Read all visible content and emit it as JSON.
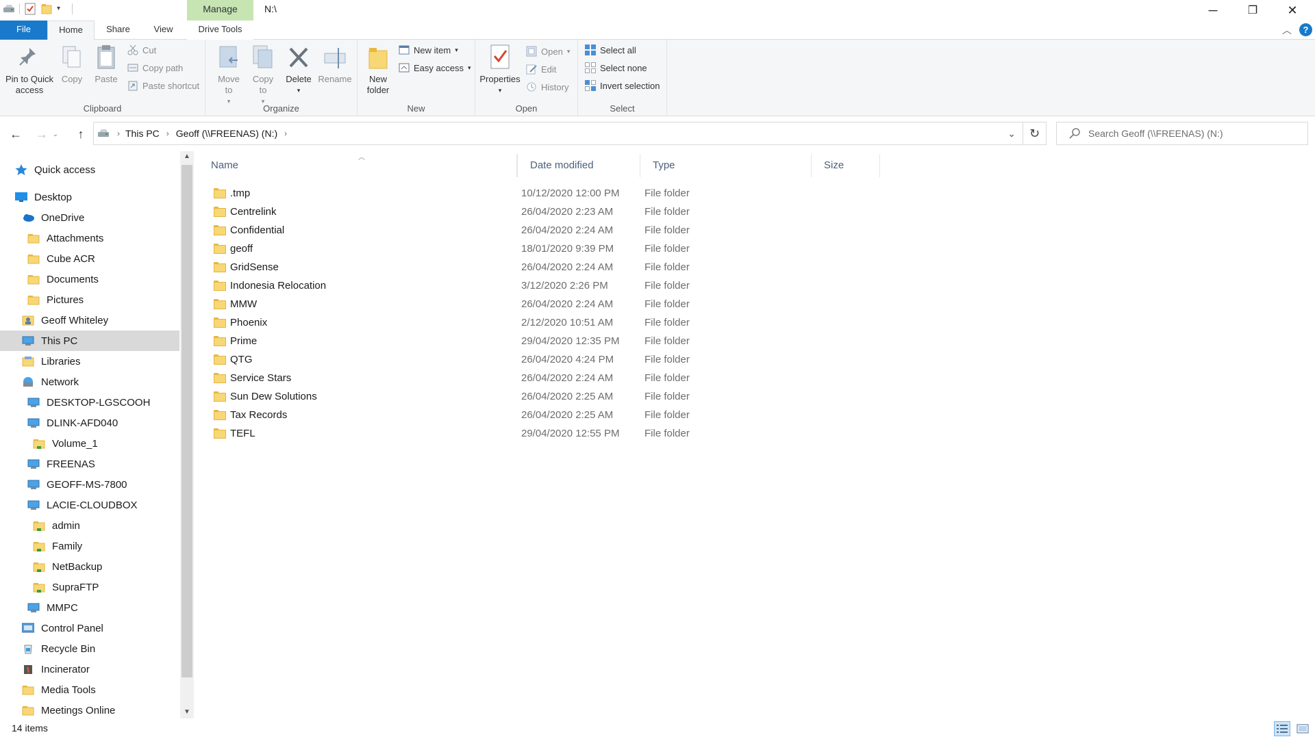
{
  "titlebar": {
    "manage_label": "Manage",
    "title": "N:\\",
    "minimize": "─",
    "restore": "❐",
    "close": "✕"
  },
  "ribbon_tabs": {
    "file": "File",
    "home": "Home",
    "share": "Share",
    "view": "View",
    "drive_tools": "Drive Tools"
  },
  "ribbon": {
    "clipboard": {
      "label": "Clipboard",
      "pin": "Pin to Quick access",
      "copy": "Copy",
      "paste": "Paste",
      "cut": "Cut",
      "copy_path": "Copy path",
      "paste_shortcut": "Paste shortcut"
    },
    "organize": {
      "label": "Organize",
      "move_to": "Move to",
      "copy_to": "Copy to",
      "delete": "Delete",
      "rename": "Rename"
    },
    "new": {
      "label": "New",
      "new_folder": "New folder",
      "new_item": "New item",
      "easy_access": "Easy access"
    },
    "open": {
      "label": "Open",
      "properties": "Properties",
      "open": "Open",
      "edit": "Edit",
      "history": "History"
    },
    "select": {
      "label": "Select",
      "select_all": "Select all",
      "select_none": "Select none",
      "invert": "Invert selection"
    }
  },
  "address": {
    "crumbs": [
      "This PC",
      "Geoff (\\\\FREENAS) (N:)"
    ],
    "search_placeholder": "Search Geoff (\\\\FREENAS) (N:)"
  },
  "nav": {
    "items": [
      {
        "label": "Quick access",
        "icon": "star-icon",
        "indent": 0
      },
      {
        "label": "Desktop",
        "icon": "desktop-icon",
        "indent": 0
      },
      {
        "label": "OneDrive",
        "icon": "cloud-icon",
        "indent": 1
      },
      {
        "label": "Attachments",
        "icon": "folder-icon",
        "indent": 2
      },
      {
        "label": "Cube ACR",
        "icon": "folder-icon",
        "indent": 2
      },
      {
        "label": "Documents",
        "icon": "folder-icon",
        "indent": 2
      },
      {
        "label": "Pictures",
        "icon": "folder-icon",
        "indent": 2
      },
      {
        "label": "Geoff Whiteley",
        "icon": "user-icon",
        "indent": 1
      },
      {
        "label": "This PC",
        "icon": "computer-icon",
        "indent": 1,
        "selected": true
      },
      {
        "label": "Libraries",
        "icon": "library-icon",
        "indent": 1
      },
      {
        "label": "Network",
        "icon": "network-icon",
        "indent": 1
      },
      {
        "label": "DESKTOP-LGSCOOH",
        "icon": "computer-icon",
        "indent": 2
      },
      {
        "label": "DLINK-AFD040",
        "icon": "computer-icon",
        "indent": 2
      },
      {
        "label": "Volume_1",
        "icon": "share-folder-icon",
        "indent": 3
      },
      {
        "label": "FREENAS",
        "icon": "computer-icon",
        "indent": 2
      },
      {
        "label": "GEOFF-MS-7800",
        "icon": "computer-icon",
        "indent": 2
      },
      {
        "label": "LACIE-CLOUDBOX",
        "icon": "computer-icon",
        "indent": 2
      },
      {
        "label": "admin",
        "icon": "share-folder-icon",
        "indent": 3
      },
      {
        "label": "Family",
        "icon": "share-folder-icon",
        "indent": 3
      },
      {
        "label": "NetBackup",
        "icon": "share-folder-icon",
        "indent": 3
      },
      {
        "label": "SupraFTP",
        "icon": "share-folder-icon",
        "indent": 3
      },
      {
        "label": "MMPC",
        "icon": "computer-icon",
        "indent": 2
      },
      {
        "label": "Control Panel",
        "icon": "control-panel-icon",
        "indent": 1
      },
      {
        "label": "Recycle Bin",
        "icon": "recycle-bin-icon",
        "indent": 1
      },
      {
        "label": "Incinerator",
        "icon": "incinerator-icon",
        "indent": 1
      },
      {
        "label": "Media Tools",
        "icon": "folder-icon",
        "indent": 1
      },
      {
        "label": "Meetings Online",
        "icon": "folder-icon",
        "indent": 1
      }
    ]
  },
  "columns": {
    "name": "Name",
    "date": "Date modified",
    "type": "Type",
    "size": "Size"
  },
  "files": [
    {
      "name": ".tmp",
      "date": "10/12/2020 12:00 PM",
      "type": "File folder"
    },
    {
      "name": "Centrelink",
      "date": "26/04/2020 2:23 AM",
      "type": "File folder"
    },
    {
      "name": "Confidential",
      "date": "26/04/2020 2:24 AM",
      "type": "File folder"
    },
    {
      "name": "geoff",
      "date": "18/01/2020 9:39 PM",
      "type": "File folder"
    },
    {
      "name": "GridSense",
      "date": "26/04/2020 2:24 AM",
      "type": "File folder"
    },
    {
      "name": "Indonesia Relocation",
      "date": "3/12/2020 2:26 PM",
      "type": "File folder"
    },
    {
      "name": "MMW",
      "date": "26/04/2020 2:24 AM",
      "type": "File folder"
    },
    {
      "name": "Phoenix",
      "date": "2/12/2020 10:51 AM",
      "type": "File folder"
    },
    {
      "name": "Prime",
      "date": "29/04/2020 12:35 PM",
      "type": "File folder"
    },
    {
      "name": "QTG",
      "date": "26/04/2020 4:24 PM",
      "type": "File folder"
    },
    {
      "name": "Service Stars",
      "date": "26/04/2020 2:24 AM",
      "type": "File folder"
    },
    {
      "name": "Sun Dew Solutions",
      "date": "26/04/2020 2:25 AM",
      "type": "File folder"
    },
    {
      "name": "Tax Records",
      "date": "26/04/2020 2:25 AM",
      "type": "File folder"
    },
    {
      "name": "TEFL",
      "date": "29/04/2020 12:55 PM",
      "type": "File folder"
    }
  ],
  "status": {
    "count": "14 items"
  },
  "colors": {
    "file_tab": "#1979ca",
    "manage_tab": "#c6e5b3",
    "selection": "#d9d9d9",
    "folder": "#f8d775"
  }
}
